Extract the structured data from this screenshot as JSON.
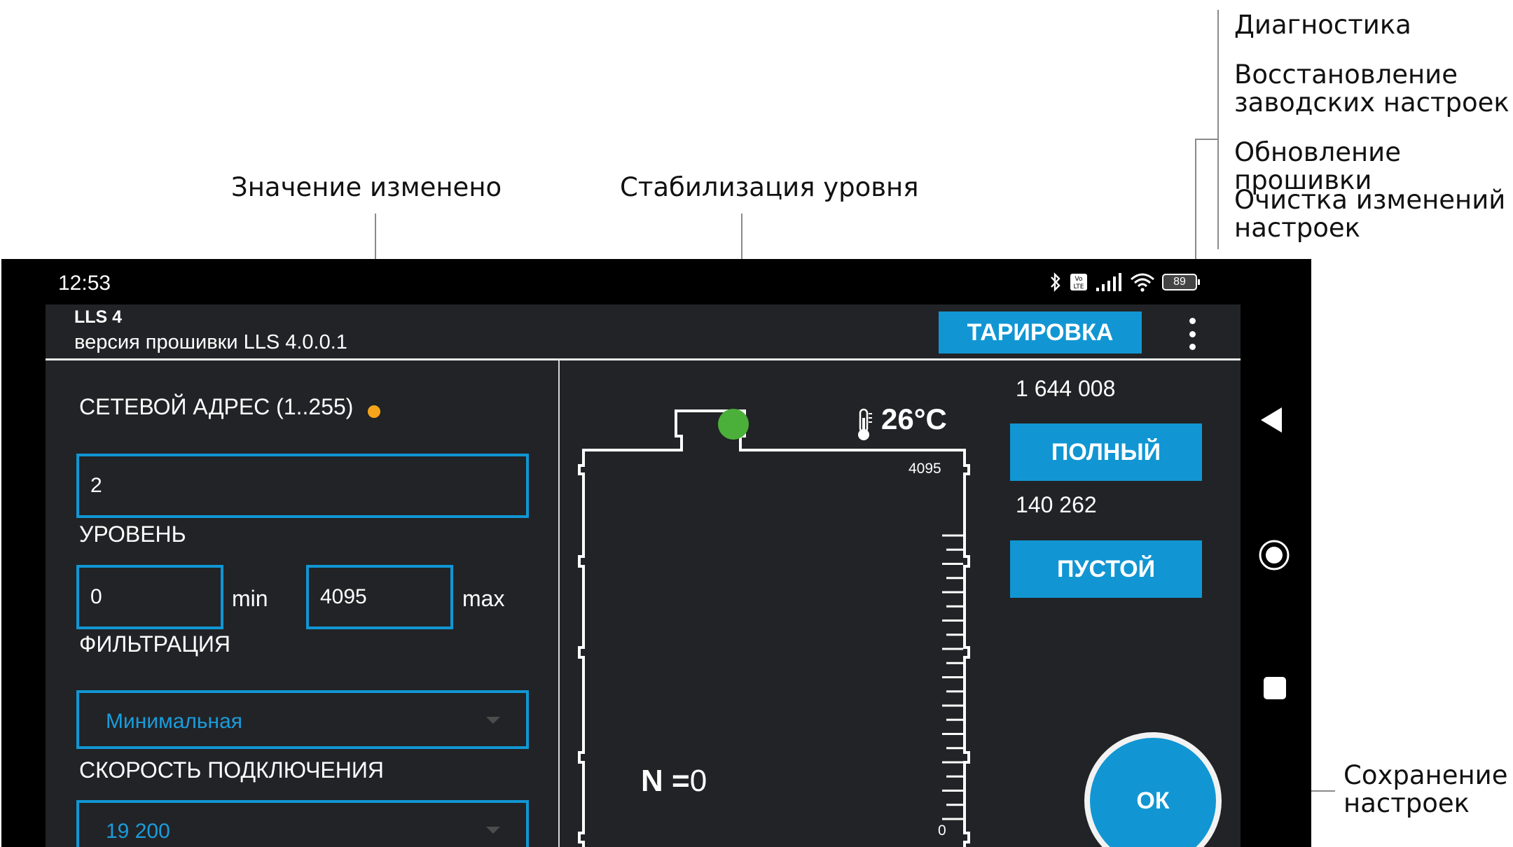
{
  "callouts": {
    "value_changed": "Значение изменено",
    "level_stabilization": "Стабилизация уровня",
    "menu": [
      "Диагностика",
      "Восстановление\nзаводских настроек",
      "Обновление прошивки",
      "Очистка изменений\nнастроек"
    ],
    "save": "Сохранение\nнастроек"
  },
  "status_bar": {
    "time": "12:53",
    "battery": "89",
    "icons": [
      "bluetooth-icon",
      "volte-icon",
      "signal-icon",
      "wifi-icon",
      "battery-icon"
    ]
  },
  "header": {
    "device": "LLS 4",
    "firmware": "версия прошивки LLS 4.0.0.1",
    "calibration_button": "ТАРИРОВКА"
  },
  "form": {
    "network_address_label": "СЕТЕВОЙ АДРЕС (1..255)",
    "network_address": "2",
    "level_label": "УРОВЕНЬ",
    "level_min": "0",
    "level_min_unit": "min",
    "level_max": "4095",
    "level_max_unit": "max",
    "filtration_label": "ФИЛЬТРАЦИЯ",
    "filtration_value": "Минимальная",
    "speed_label": "СКОРОСТЬ ПОДКЛЮЧЕНИЯ",
    "speed_value": "19 200"
  },
  "tank": {
    "temperature": "26°C",
    "top_scale": "4095",
    "bottom_scale": "0",
    "n_label": "N =",
    "n_value": "0"
  },
  "calibration": {
    "full_value": "1 644 008",
    "full_button": "ПОЛНЫЙ",
    "empty_value": "140 262",
    "empty_button": "ПУСТОЙ"
  },
  "ok_button": "ОК",
  "colors": {
    "accent": "#1196d3",
    "changed_indicator": "#f6a51b",
    "stable_indicator": "#4bb039",
    "background": "#222326"
  }
}
